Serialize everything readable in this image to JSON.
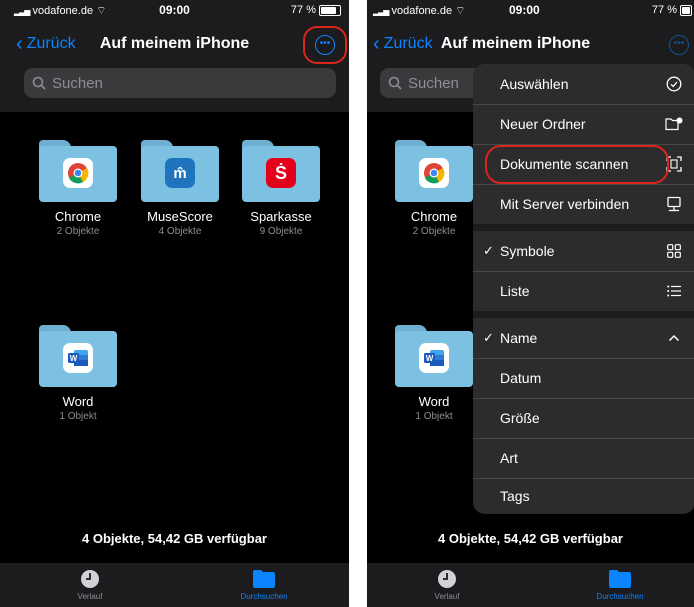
{
  "status_bar": {
    "carrier": "vodafone.de",
    "time": "09:00",
    "battery": "77 %"
  },
  "nav": {
    "back_label": "Zurück",
    "title": "Auf meinem iPhone"
  },
  "search": {
    "placeholder": "Suchen"
  },
  "folders": [
    {
      "name": "Chrome",
      "count": "2 Objekte",
      "icon": "chrome-icon"
    },
    {
      "name": "MuseScore",
      "count": "4 Objekte",
      "icon": "musescore-icon"
    },
    {
      "name": "Sparkasse",
      "count": "9 Objekte",
      "icon": "sparkasse-icon"
    },
    {
      "name": "Word",
      "count": "1 Objekt",
      "icon": "word-icon"
    }
  ],
  "footer": {
    "summary": "4 Objekte, 54,42 GB verfügbar"
  },
  "tabs": [
    {
      "label": "Verlauf",
      "icon": "clock-icon",
      "active": false
    },
    {
      "label": "Durchsuchen",
      "icon": "folder-icon",
      "active": true
    }
  ],
  "menu": {
    "items": [
      {
        "label": "Auswählen",
        "icon": "checkmark-circle-icon"
      },
      {
        "label": "Neuer Ordner",
        "icon": "new-folder-icon"
      },
      {
        "label": "Dokumente scannen",
        "icon": "document-scanner-icon"
      },
      {
        "label": "Mit Server verbinden",
        "icon": "server-icon"
      },
      {
        "label": "Symbole",
        "icon": "grid-icon",
        "checked": true
      },
      {
        "label": "Liste",
        "icon": "list-icon"
      },
      {
        "label": "Name",
        "icon": "chevron-up-icon",
        "checked": true
      },
      {
        "label": "Datum"
      },
      {
        "label": "Größe"
      },
      {
        "label": "Art"
      },
      {
        "label": "Tags"
      }
    ],
    "checkmark": "✓"
  },
  "colors": {
    "accent": "#0a84ff",
    "highlight": "#d9251c",
    "folder": "#7cc0e2",
    "background": "#000000"
  }
}
